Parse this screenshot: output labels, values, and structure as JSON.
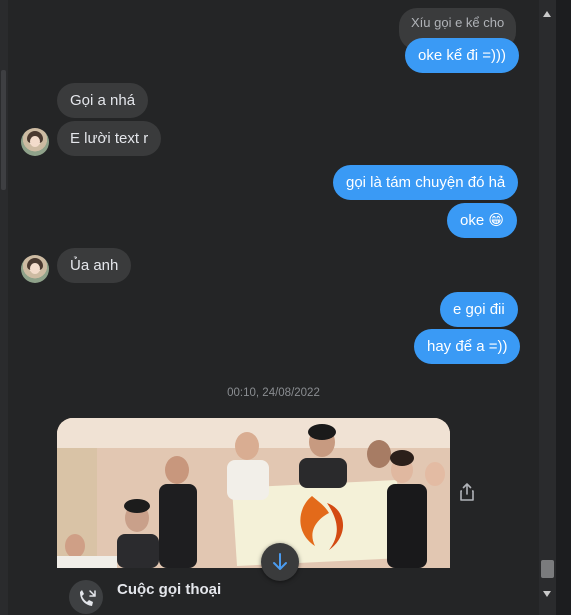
{
  "conversation": {
    "reply_preview": "Xíu gọi e kể cho",
    "messages": [
      {
        "id": "m1",
        "text": "oke kể đi =)))"
      },
      {
        "id": "m2",
        "text": "Gọi a nhá"
      },
      {
        "id": "m3",
        "text": "E lười text r"
      },
      {
        "id": "m4",
        "text": "gọi là tám chuyện đó hả"
      },
      {
        "id": "m5",
        "text": "oke 😁"
      },
      {
        "id": "m6",
        "text": "Ủa anh"
      },
      {
        "id": "m7",
        "text": "e gọi đii"
      },
      {
        "id": "m8",
        "text": "hay để a =))"
      }
    ],
    "timestamp": "00:10, 24/08/2022",
    "call": {
      "title": "Cuộc gọi thoại"
    }
  },
  "colors": {
    "outgoing_bubble": "#3a9af5",
    "incoming_bubble": "#3a3b3c",
    "background": "#242526"
  },
  "icons": {
    "share": "share-icon",
    "scroll_down": "arrow-down-icon",
    "call": "missed-call-icon"
  }
}
